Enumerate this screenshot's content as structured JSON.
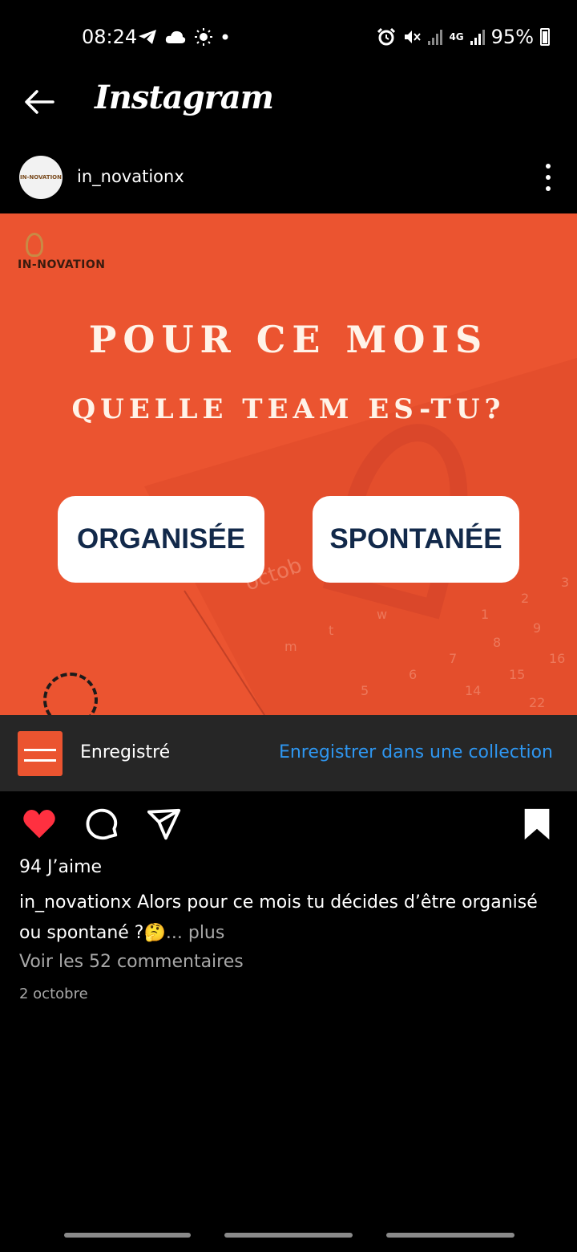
{
  "status_bar": {
    "time": "08:24",
    "network": "4G",
    "battery": "95%"
  },
  "header": {
    "title": "Instagram"
  },
  "post": {
    "username": "in_novationx",
    "image": {
      "logo_text": "IN-NOVATION",
      "headline_1": "POUR CE MOIS",
      "headline_2": "QUELLE TEAM ES-TU?",
      "option_left": "ORGANISÉE",
      "option_right": "SPONTANÉE",
      "background_color": "#eb5430"
    },
    "saved_bar": {
      "label": "Enregistré",
      "link": "Enregistrer dans une collection"
    },
    "likes": "94 J’aime",
    "caption_user": "in_novationx",
    "caption_text": " Alors pour ce mois tu décides d’être organisé ou spontané ?🤔",
    "caption_more": "... plus",
    "comments_link": "Voir les 52 commentaires",
    "date": "2 octobre"
  },
  "colors": {
    "like_red": "#ff3040",
    "link_blue": "#2e96f0",
    "button_text": "#12294a"
  }
}
